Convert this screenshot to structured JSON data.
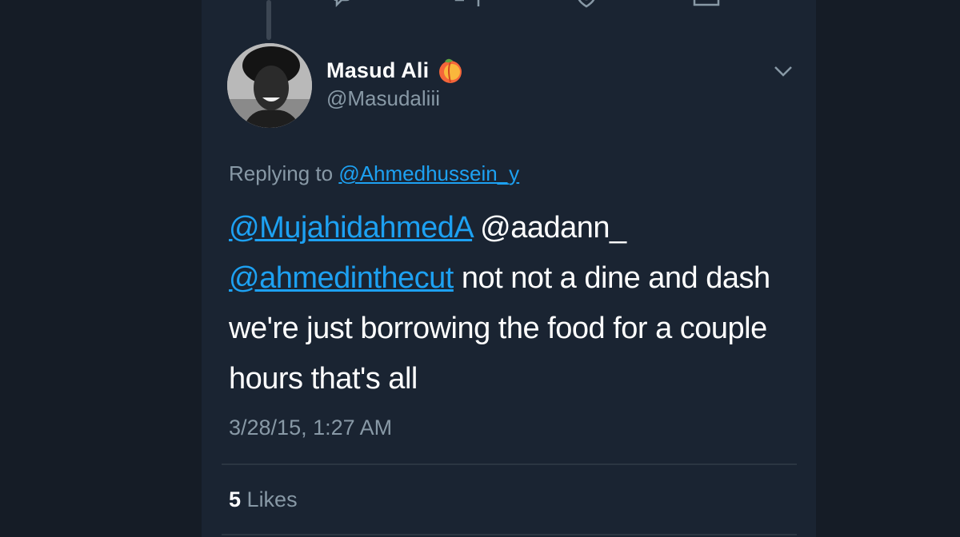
{
  "tweet": {
    "author": {
      "display_name": "Masud Ali",
      "handle": "@Masudaliii",
      "name_emoji": "peach-emoji"
    },
    "replying_prefix": "Replying to",
    "replying_to": "@Ahmedhussein_y",
    "mention_1": "@MujahidahmedA",
    "text_1": " @aadann_",
    "mention_2": "@ahmedinthecut",
    "text_2": " not not a dine and dash we're just borrowing the food for a couple hours that's all",
    "timestamp": "3/28/15, 1:27 AM",
    "likes_count": "5",
    "likes_label": "Likes"
  },
  "icons": {
    "menu": "chevron-down-icon",
    "top_actions": [
      "reply-icon",
      "retweet-icon",
      "like-icon",
      "share-icon"
    ]
  },
  "colors": {
    "background": "#151c26",
    "card": "#1a2432",
    "link": "#1da1f2",
    "secondary_text": "#8899a6",
    "primary_text": "#ffffff"
  }
}
